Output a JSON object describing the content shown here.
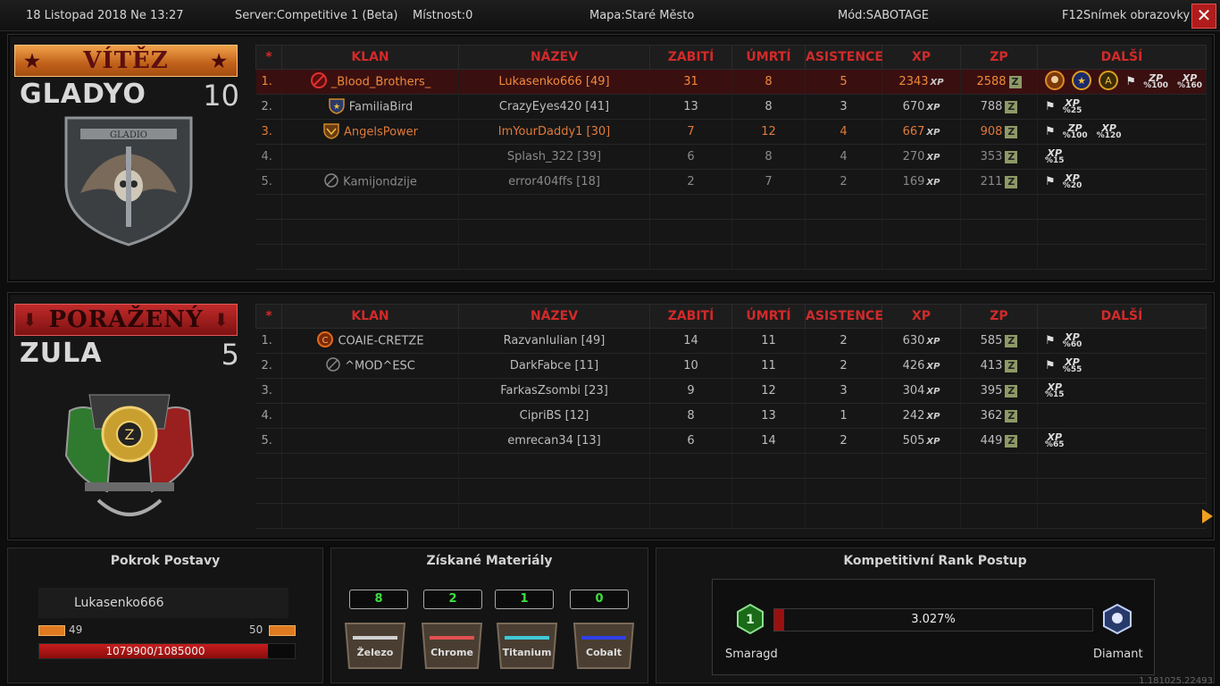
{
  "topbar": {
    "date": "18 Listopad 2018 Ne 13:27",
    "server": "Server:Competitive 1 (Beta)",
    "room": "Místnost:0",
    "map": "Mapa:Staré Město",
    "mode": "Mód:SABOTAGE",
    "screenshot": "F12Snímek obrazovky",
    "close": "✕"
  },
  "headers": {
    "star": "*",
    "clan": "KLAN",
    "name": "NÁZEV",
    "kills": "ZABITÍ",
    "deaths": "ÚMRTÍ",
    "assists": "ASISTENCE",
    "xp": "XP",
    "zp": "ZP",
    "extra": "DALŠÍ"
  },
  "xp_tag": "XP",
  "zp_tag": "Z",
  "winner": {
    "banner": "VÍTĚZ",
    "team": "GLADYO",
    "score": "10",
    "emblem_text": "GLADIO",
    "players": [
      {
        "rank": "1.",
        "clan": "_Blood_Brothers_",
        "name": "Lukasenko666 [49]",
        "kills": "31",
        "deaths": "8",
        "assists": "5",
        "xp": "2343",
        "zp": "2588",
        "bonuses": [
          {
            "t": "ZP",
            "p": "%100"
          },
          {
            "t": "XP",
            "p": "%160"
          }
        ]
      },
      {
        "rank": "2.",
        "clan": "FamiliaBird",
        "name": "CrazyEyes420 [41]",
        "kills": "13",
        "deaths": "8",
        "assists": "3",
        "xp": "670",
        "zp": "788",
        "bonuses": [
          {
            "t": "XP",
            "p": "%25"
          }
        ]
      },
      {
        "rank": "3.",
        "clan": "AngelsPower",
        "name": "ImYourDaddy1 [30]",
        "kills": "7",
        "deaths": "12",
        "assists": "4",
        "xp": "667",
        "zp": "908",
        "bonuses": [
          {
            "t": "ZP",
            "p": "%100"
          },
          {
            "t": "XP",
            "p": "%120"
          }
        ]
      },
      {
        "rank": "4.",
        "clan": "",
        "name": "Splash_322 [39]",
        "kills": "6",
        "deaths": "8",
        "assists": "4",
        "xp": "270",
        "zp": "353",
        "bonuses": [
          {
            "t": "XP",
            "p": "%15"
          }
        ]
      },
      {
        "rank": "5.",
        "clan": "Kamijondzije",
        "name": "error404ffs [18]",
        "kills": "2",
        "deaths": "7",
        "assists": "2",
        "xp": "169",
        "zp": "211",
        "bonuses": [
          {
            "t": "XP",
            "p": "%20"
          }
        ]
      }
    ]
  },
  "loser": {
    "banner": "PORAŽENÝ",
    "team": "ZULA",
    "score": "5",
    "players": [
      {
        "rank": "1.",
        "clan": "COAIE-CRETZE",
        "name": "RazvanIulian [49]",
        "kills": "14",
        "deaths": "11",
        "assists": "2",
        "xp": "630",
        "zp": "585",
        "bonuses": [
          {
            "t": "XP",
            "p": "%60"
          }
        ]
      },
      {
        "rank": "2.",
        "clan": "^MOD^ESC",
        "name": "DarkFabce [11]",
        "kills": "10",
        "deaths": "11",
        "assists": "2",
        "xp": "426",
        "zp": "413",
        "bonuses": [
          {
            "t": "XP",
            "p": "%55"
          }
        ]
      },
      {
        "rank": "3.",
        "clan": "",
        "name": "FarkasZsombi [23]",
        "kills": "9",
        "deaths": "12",
        "assists": "3",
        "xp": "304",
        "zp": "395",
        "bonuses": [
          {
            "t": "XP",
            "p": "%15"
          }
        ]
      },
      {
        "rank": "4.",
        "clan": "",
        "name": "CipriBS [12]",
        "kills": "8",
        "deaths": "13",
        "assists": "1",
        "xp": "242",
        "zp": "362",
        "bonuses": []
      },
      {
        "rank": "5.",
        "clan": "",
        "name": "emrecan34 [13]",
        "kills": "6",
        "deaths": "14",
        "assists": "2",
        "xp": "505",
        "zp": "449",
        "bonuses": [
          {
            "t": "XP",
            "p": "%65"
          }
        ]
      }
    ]
  },
  "progress": {
    "title": "Pokrok Postavy",
    "player": "Lukasenko666",
    "level_current": "49",
    "level_next": "50",
    "exp_text": "1079900/1085000",
    "fraction": 0.9953
  },
  "materials": {
    "title": "Získané Materiály",
    "items": [
      {
        "count": "8",
        "label": "Železo",
        "color": "#cfcfcf"
      },
      {
        "count": "2",
        "label": "Chrome",
        "color": "#e05050"
      },
      {
        "count": "1",
        "label": "Titanium",
        "color": "#40c8d8"
      },
      {
        "count": "0",
        "label": "Cobalt",
        "color": "#3040e8"
      }
    ]
  },
  "rank": {
    "title": "Kompetitivní Rank Postup",
    "percent_text": "3.027%",
    "fraction": 0.03027,
    "from": "Smaragd",
    "to": "Diamant"
  },
  "version": "1.181025.22493",
  "colors": {
    "accent_red": "#d22a2a",
    "highlight_orange": "#f08a3a",
    "material_count": "#3ee03e"
  }
}
